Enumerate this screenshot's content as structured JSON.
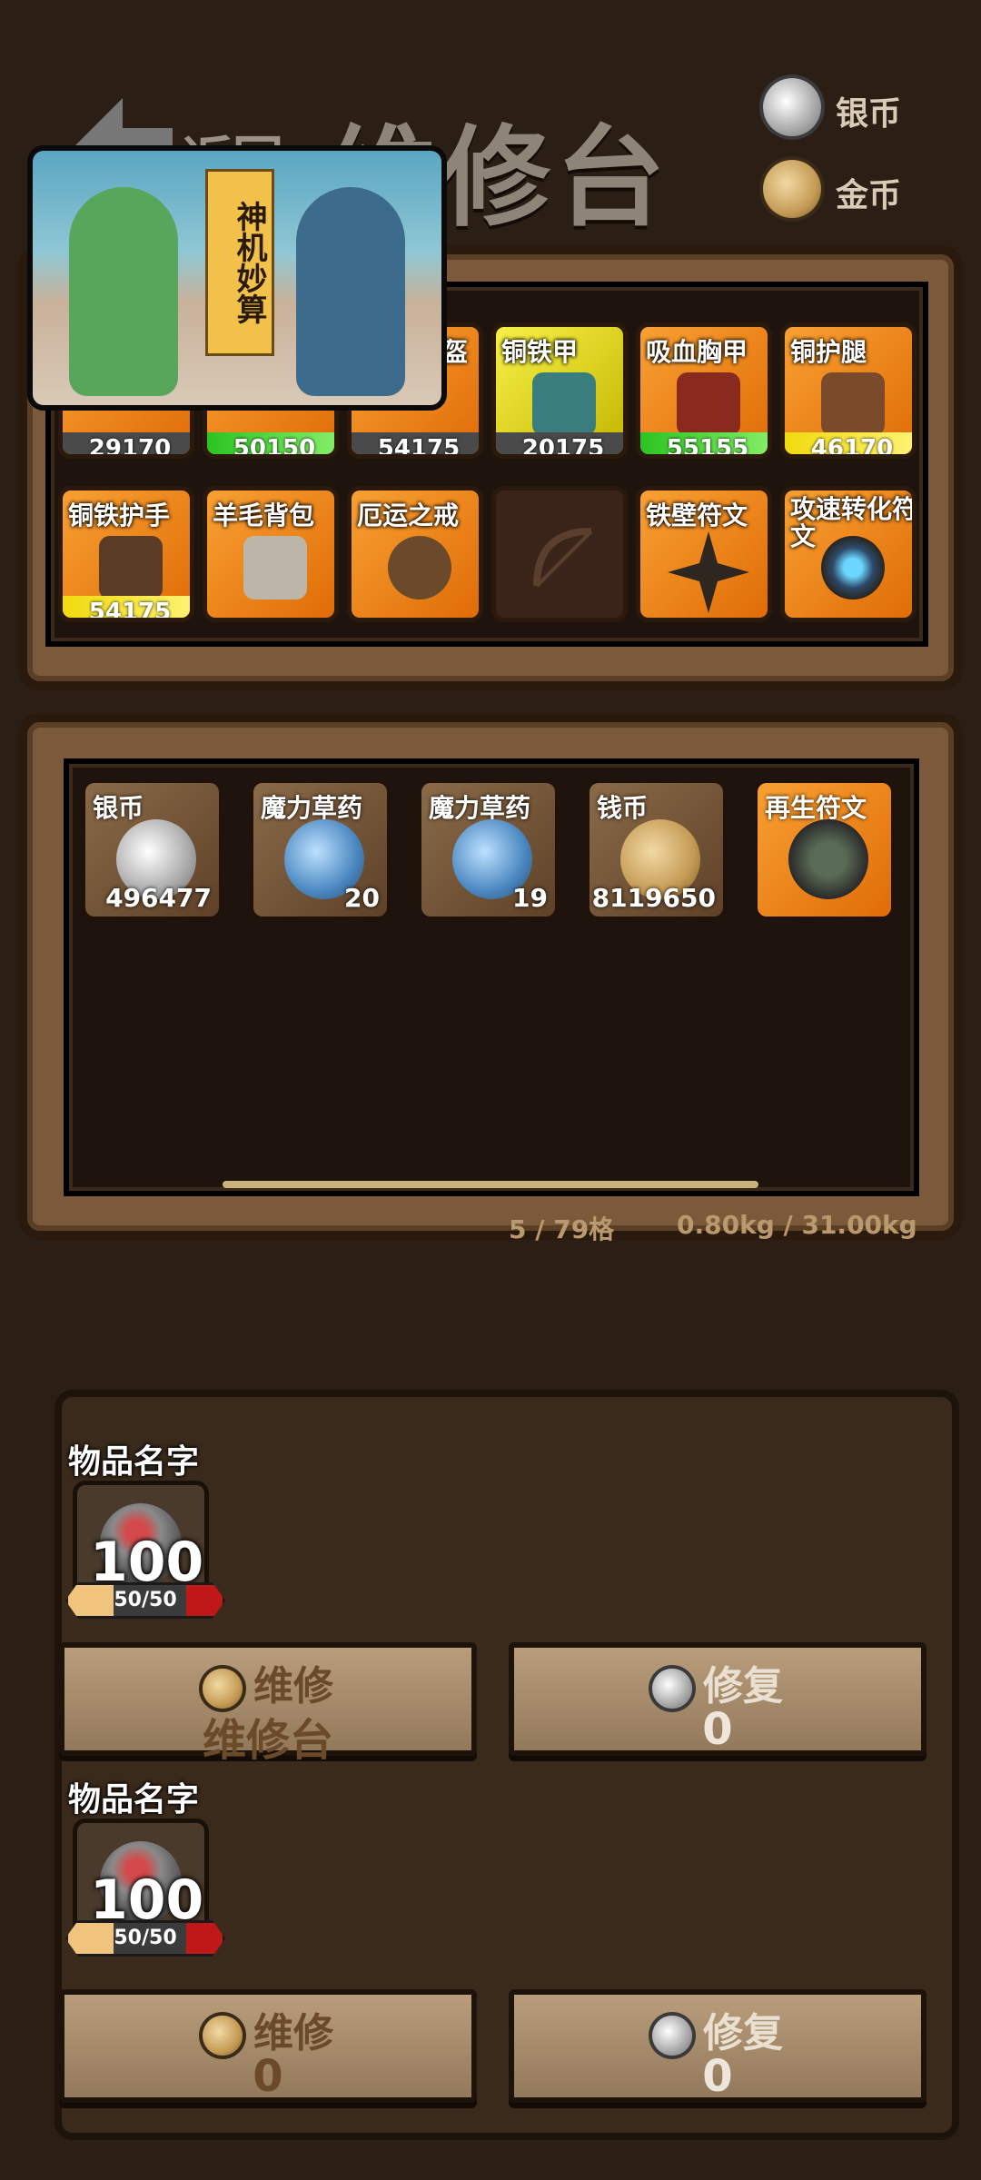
{
  "header": {
    "title": "维修台",
    "back_label": "返回",
    "currencies": [
      {
        "label": "银币",
        "icon": "silver-coin-icon"
      },
      {
        "label": "金币",
        "icon": "gold-coin-icon"
      }
    ]
  },
  "video": {
    "banner_text": "神机妙算"
  },
  "equipment": {
    "row1": [
      {
        "name": "",
        "value": "29170",
        "color": "orange",
        "ribbon": "gray"
      },
      {
        "name": "",
        "value": "50150",
        "color": "orange",
        "ribbon": "green"
      },
      {
        "name": "盔",
        "value": "54175",
        "color": "orange",
        "ribbon": "gray"
      },
      {
        "name": "铜铁甲",
        "value": "20175",
        "color": "yellow",
        "ribbon": "gray"
      },
      {
        "name": "吸血胸甲",
        "value": "55155",
        "color": "orange",
        "ribbon": "green"
      },
      {
        "name": "铜护腿",
        "value": "46170",
        "color": "orange",
        "ribbon": "yellow"
      }
    ],
    "row2": [
      {
        "name": "铜铁护手",
        "value": "54175",
        "color": "orange",
        "ribbon": "yellow"
      },
      {
        "name": "羊毛背包",
        "value": "",
        "color": "orange"
      },
      {
        "name": "厄运之戒",
        "value": "",
        "color": "orange"
      },
      {
        "name": "",
        "value": "",
        "color": "empty"
      },
      {
        "name": "铁壁符文",
        "value": "",
        "color": "orange"
      },
      {
        "name": "攻速转化符文",
        "value": "",
        "color": "orange"
      }
    ]
  },
  "bag": {
    "items": [
      {
        "name": "银币",
        "count": "496477",
        "icon": "silver"
      },
      {
        "name": "魔力草药",
        "count": "20",
        "icon": "potion"
      },
      {
        "name": "魔力草药",
        "count": "19",
        "icon": "potion"
      },
      {
        "name": "钱币",
        "count": "8119650",
        "icon": "gold"
      },
      {
        "name": "再生符文",
        "count": "",
        "icon": "rune"
      }
    ],
    "capacity": "5 / 79格",
    "weight": "0.80kg / 31.00kg"
  },
  "repair": {
    "items": [
      {
        "title": "物品名字",
        "level": "100",
        "durability": "50/50",
        "btn1": {
          "top": "维修",
          "bottom": "维修台"
        },
        "btn2": {
          "top": "修复",
          "bottom": "0"
        }
      },
      {
        "title": "物品名字",
        "level": "100",
        "durability": "50/50",
        "btn1": {
          "top": "维修",
          "bottom": "0"
        },
        "btn2": {
          "top": "修复",
          "bottom": "0"
        }
      }
    ]
  },
  "colors": {
    "accent_orange": "#f08a1c",
    "green": "#27c21f",
    "yellow": "#f0d90a"
  }
}
